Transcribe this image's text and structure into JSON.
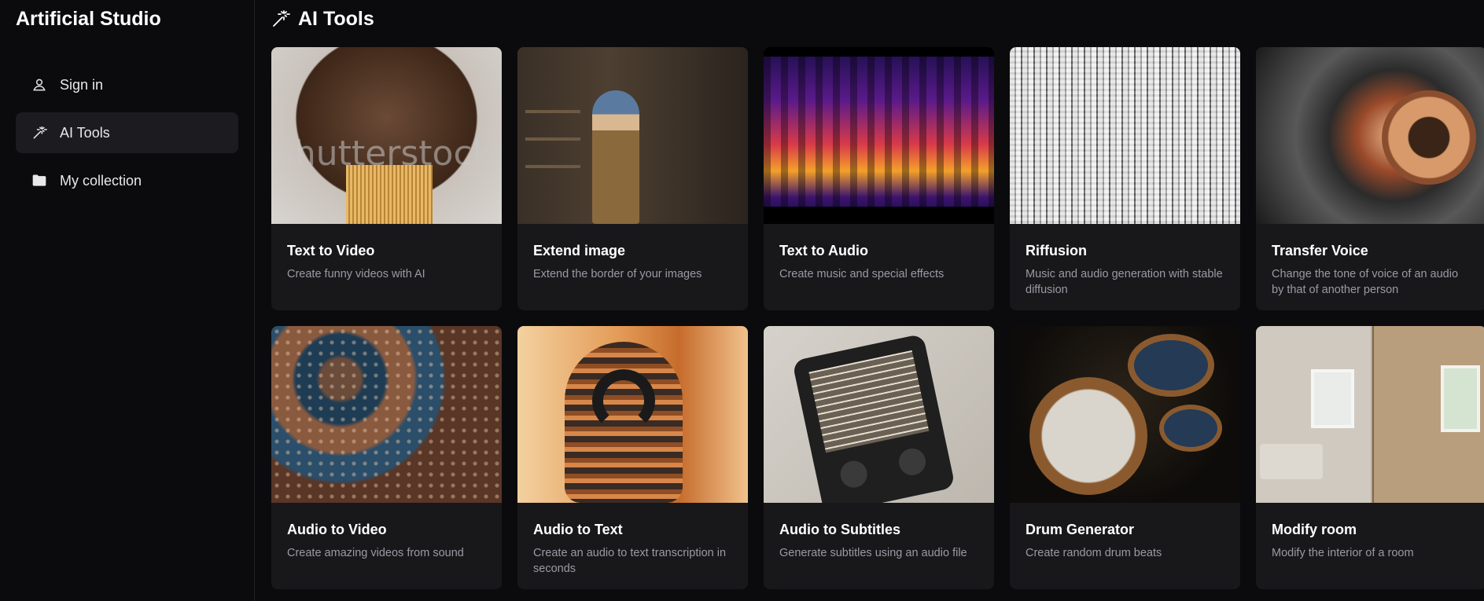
{
  "sidebar": {
    "brand": "Artificial Studio",
    "items": [
      {
        "label": "Sign in",
        "icon": "user-icon"
      },
      {
        "label": "AI Tools",
        "icon": "magic-wand-icon",
        "active": true
      },
      {
        "label": "My collection",
        "icon": "folder-icon"
      }
    ]
  },
  "header": {
    "title": "AI Tools",
    "icon": "magic-wand-icon"
  },
  "tools": [
    {
      "title": "Text to Video",
      "description": "Create funny videos with AI",
      "watermark": "shutterstock"
    },
    {
      "title": "Extend image",
      "description": "Extend the border of your images"
    },
    {
      "title": "Text to Audio",
      "description": "Create music and special effects"
    },
    {
      "title": "Riffusion",
      "description": "Music and audio generation with stable diffusion"
    },
    {
      "title": "Transfer Voice",
      "description": "Change the tone of voice of an audio by that of another person"
    },
    {
      "title": "Audio to Video",
      "description": "Create amazing videos from sound"
    },
    {
      "title": "Audio to Text",
      "description": "Create an audio to text transcription in seconds"
    },
    {
      "title": "Audio to Subtitles",
      "description": "Generate subtitles using an audio file"
    },
    {
      "title": "Drum Generator",
      "description": "Create random drum beats"
    },
    {
      "title": "Modify room",
      "description": "Modify the interior of a room"
    }
  ],
  "colors": {
    "background": "#0b0b0d",
    "card": "#18181b",
    "active_nav": "#1c1c20",
    "muted_text": "#9a9aa2"
  }
}
